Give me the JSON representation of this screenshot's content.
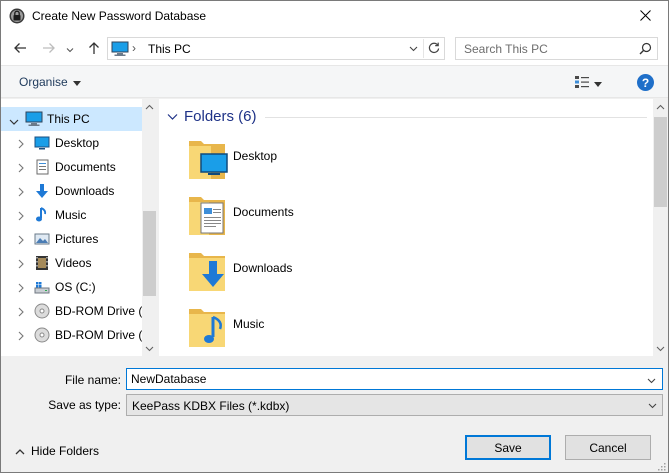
{
  "window": {
    "title": "Create New Password Database",
    "close_icon": "close-icon"
  },
  "address_bar": {
    "location": "This PC",
    "separator": "›",
    "search_placeholder": "Search This PC"
  },
  "toolbar": {
    "organise_label": "Organise",
    "help_label": "?"
  },
  "navigation": {
    "items": [
      {
        "label": "This PC",
        "icon": "computer-icon",
        "selected": true,
        "expanded": true
      },
      {
        "label": "Desktop",
        "icon": "desktop-icon"
      },
      {
        "label": "Documents",
        "icon": "documents-icon"
      },
      {
        "label": "Downloads",
        "icon": "downloads-icon"
      },
      {
        "label": "Music",
        "icon": "music-icon"
      },
      {
        "label": "Pictures",
        "icon": "pictures-icon"
      },
      {
        "label": "Videos",
        "icon": "videos-icon"
      },
      {
        "label": "OS (C:)",
        "icon": "drive-icon"
      },
      {
        "label": "BD-ROM Drive (I",
        "icon": "disc-icon"
      },
      {
        "label": "BD-ROM Drive (I",
        "icon": "disc-icon"
      }
    ]
  },
  "content": {
    "group_title": "Folders (6)",
    "folders": [
      {
        "label": "Desktop",
        "icon": "desktop-folder-icon"
      },
      {
        "label": "Documents",
        "icon": "documents-folder-icon"
      },
      {
        "label": "Downloads",
        "icon": "downloads-folder-icon"
      },
      {
        "label": "Music",
        "icon": "music-folder-icon"
      }
    ]
  },
  "form": {
    "file_name_label": "File name:",
    "file_name_value": "NewDatabase",
    "save_type_label": "Save as type:",
    "save_type_value": "KeePass KDBX Files (*.kdbx)"
  },
  "footer": {
    "hide_folders_label": "Hide Folders",
    "save_label": "Save",
    "cancel_label": "Cancel"
  },
  "colors": {
    "accent": "#0078d7",
    "selection": "#cce8ff",
    "folder": "#f8d775",
    "group_title": "#1e3287"
  }
}
